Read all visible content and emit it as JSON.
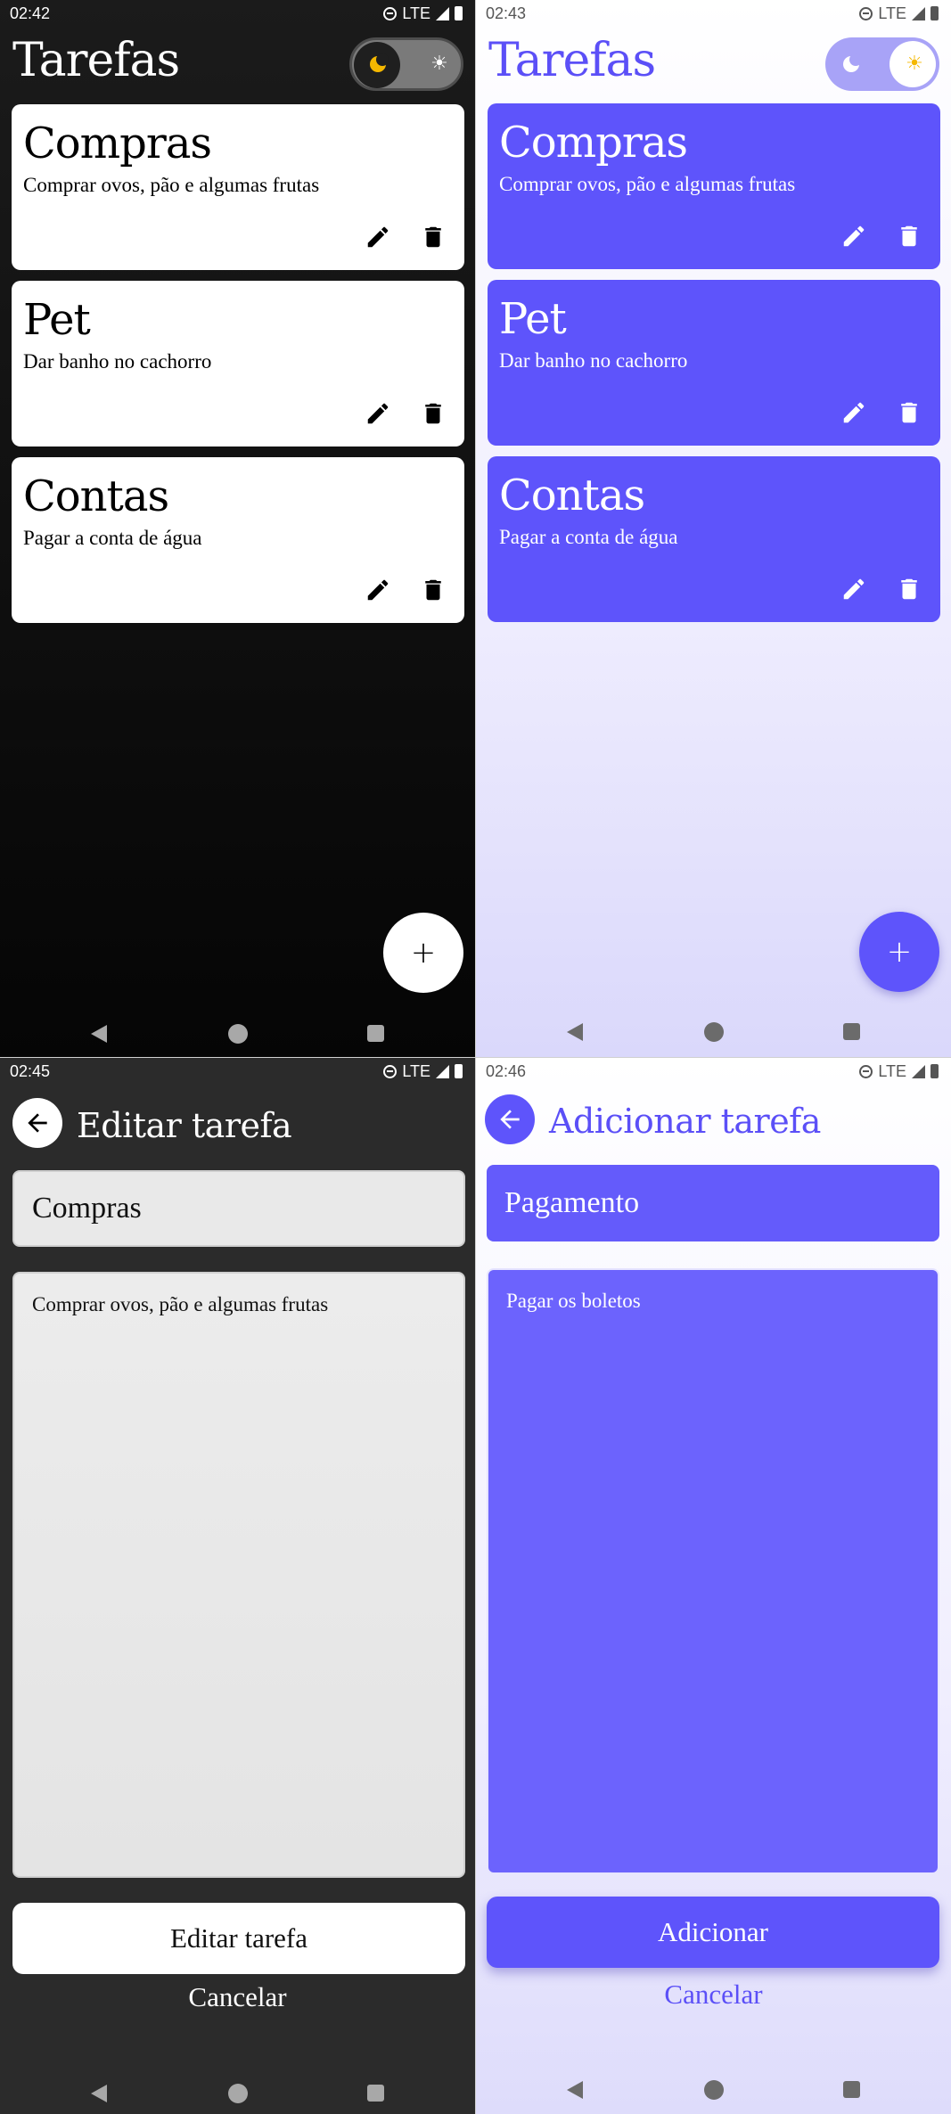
{
  "screens": {
    "list_dark": {
      "time": "02:42",
      "network": "LTE",
      "title": "Tarefas",
      "tasks": [
        {
          "title": "Compras",
          "description": "Comprar ovos, pão e algumas frutas"
        },
        {
          "title": "Pet",
          "description": "Dar banho no cachorro"
        },
        {
          "title": "Contas",
          "description": "Pagar a conta de água"
        }
      ],
      "fab_label": "+",
      "theme": "dark"
    },
    "list_light": {
      "time": "02:43",
      "network": "LTE",
      "title": "Tarefas",
      "tasks": [
        {
          "title": "Compras",
          "description": "Comprar ovos, pão e algumas frutas"
        },
        {
          "title": "Pet",
          "description": "Dar banho no cachorro"
        },
        {
          "title": "Contas",
          "description": "Pagar a conta de água"
        }
      ],
      "fab_label": "+",
      "theme": "light"
    },
    "edit_dark": {
      "time": "02:45",
      "network": "LTE",
      "title": "Editar tarefa",
      "task_title_value": "Compras",
      "task_description_value": "Comprar ovos, pão e algumas frutas",
      "submit_label": "Editar tarefa",
      "cancel_label": "Cancelar"
    },
    "add_light": {
      "time": "02:46",
      "network": "LTE",
      "title": "Adicionar tarefa",
      "task_title_value": "Pagamento",
      "task_description_value": "Pagar os boletos",
      "submit_label": "Adicionar",
      "cancel_label": "Cancelar"
    }
  },
  "icons": {
    "moon": "moon-icon",
    "sun": "sun-icon",
    "edit": "pencil-icon",
    "delete": "trash-icon",
    "back": "arrow-left-icon",
    "add": "plus-icon"
  },
  "colors": {
    "accent": "#5e54fb",
    "accent_text": "#5b4ff7",
    "dark_bg": "#121212",
    "moon_yellow": "#f5b800",
    "sun_yellow": "#f5b800"
  }
}
